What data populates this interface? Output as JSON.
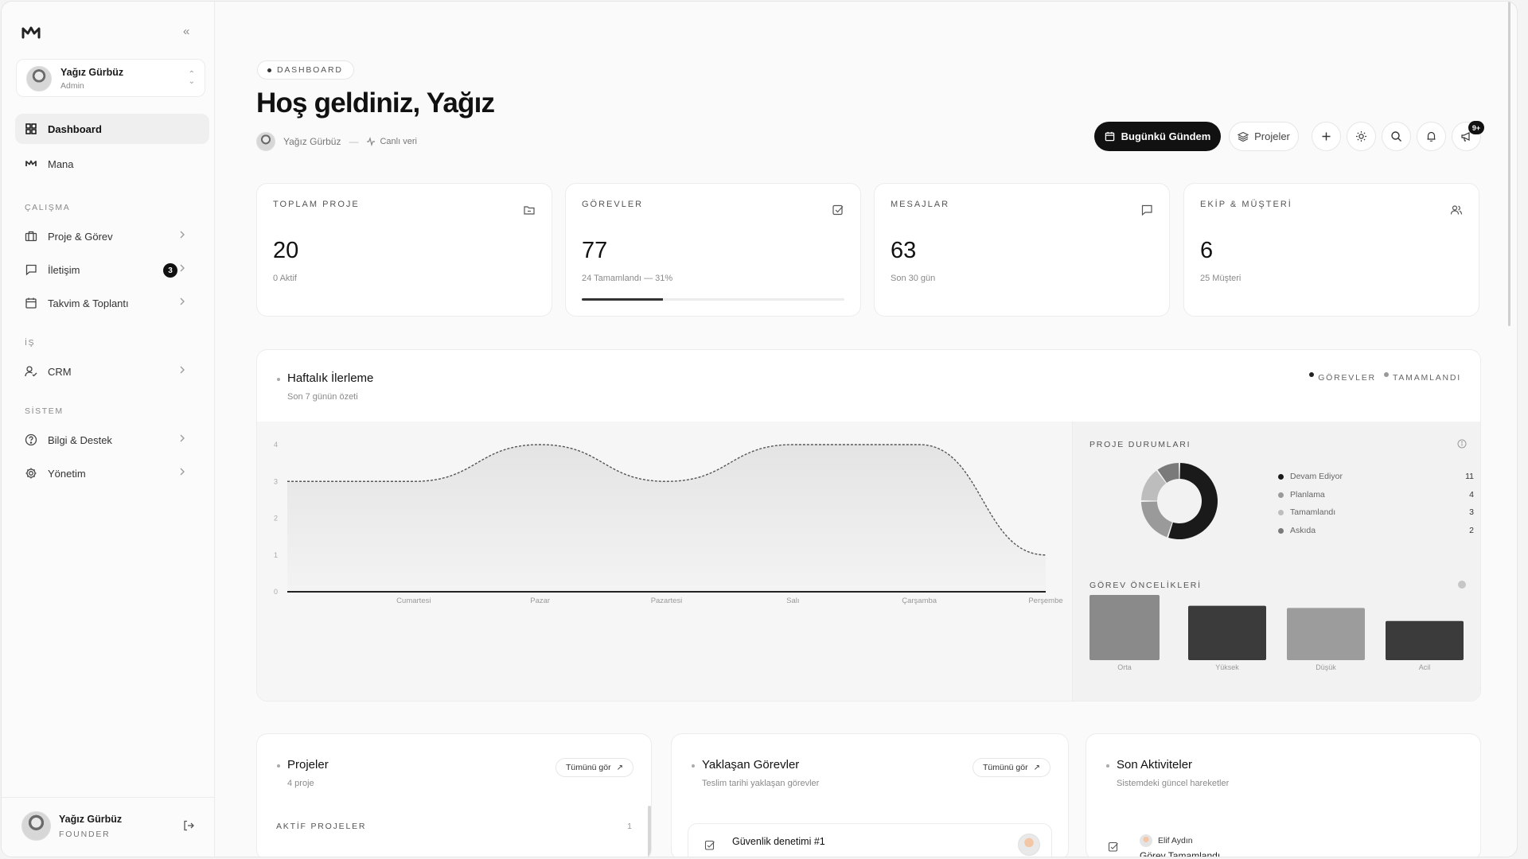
{
  "sidebar": {
    "user": {
      "name": "Yağız Gürbüz",
      "role": "Admin"
    },
    "nav_top": [
      {
        "label": "Dashboard",
        "icon": "dashboard-icon",
        "active": true
      },
      {
        "label": "Mana",
        "icon": "mana-logo-icon"
      }
    ],
    "sections": [
      {
        "label": "ÇALIŞMA",
        "items": [
          {
            "label": "Proje & Görev",
            "icon": "briefcase-icon"
          },
          {
            "label": "İletişim",
            "icon": "chat-icon",
            "badge": "3"
          },
          {
            "label": "Takvim & Toplantı",
            "icon": "calendar-icon"
          }
        ]
      },
      {
        "label": "İŞ",
        "items": [
          {
            "label": "CRM",
            "icon": "user-check-icon"
          }
        ]
      },
      {
        "label": "SİSTEM",
        "items": [
          {
            "label": "Bilgi & Destek",
            "icon": "help-icon"
          },
          {
            "label": "Yönetim",
            "icon": "gear-icon"
          }
        ]
      }
    ],
    "footer": {
      "name": "Yağız Gürbüz",
      "role": "FOUNDER"
    }
  },
  "header": {
    "breadcrumb": "DASHBOARD",
    "title": "Hoş geldiniz, Yağız",
    "user": "Yağız Gürbüz",
    "live": "Canlı veri",
    "agenda_button": "Bugünkü Gündem",
    "projects_button": "Projeler",
    "notif_badge": "9+"
  },
  "stats": [
    {
      "label": "TOPLAM PROJE",
      "value": "20",
      "sub": "0 Aktif",
      "icon": "folder-icon"
    },
    {
      "label": "GÖREVLER",
      "value": "77",
      "sub": "24 Tamamlandı — 31%",
      "icon": "check-square-icon",
      "progress": 0.31
    },
    {
      "label": "MESAJLAR",
      "value": "63",
      "sub": "Son 30 gün",
      "icon": "message-icon"
    },
    {
      "label": "EKİP & MÜŞTERİ",
      "value": "6",
      "sub": "25 Müşteri",
      "icon": "users-icon"
    }
  ],
  "weekly": {
    "title": "Haftalık İlerleme",
    "subtitle": "Son 7 günün özeti",
    "legend": [
      "GÖREVLER",
      "TAMAMLANDI"
    ],
    "status_title": "PROJE DURUMLARI",
    "priority_title": "GÖREV ÖNCELİKLERİ"
  },
  "chart_data": [
    {
      "type": "area",
      "title": "Haftalık İlerleme",
      "x": [
        "",
        "Cumartesi",
        "Pazar",
        "Pazartesi",
        "Salı",
        "Çarşamba",
        "Perşembe"
      ],
      "series": [
        {
          "name": "GÖREVLER",
          "values": [
            3,
            3,
            4,
            3,
            4,
            4,
            1
          ]
        },
        {
          "name": "TAMAMLANDI",
          "values": [
            0,
            0,
            0,
            0,
            0,
            0,
            0
          ]
        }
      ],
      "yticks": [
        "0",
        "1",
        "2",
        "3",
        "4"
      ],
      "ylim": [
        0,
        4
      ],
      "colors": {
        "line": "#555555",
        "fill": "#e4e4e4"
      }
    },
    {
      "type": "pie",
      "title": "PROJE DURUMLARI",
      "categories": [
        "Devam Ediyor",
        "Planlama",
        "Tamamlandı",
        "Askıda"
      ],
      "values": [
        11,
        4,
        3,
        2
      ],
      "colors": [
        "#1a1a1a",
        "#9a9a9a",
        "#bdbdbd",
        "#7a7a7a"
      ]
    },
    {
      "type": "bar",
      "title": "GÖREV ÖNCELİKLERİ",
      "categories": [
        "Orta",
        "Yüksek",
        "Düşük",
        "Acil"
      ],
      "values": [
        30,
        25,
        24,
        18
      ],
      "colors": [
        "#8a8a8a",
        "#3b3b3b",
        "#9c9c9c",
        "#3b3b3b"
      ]
    }
  ],
  "bottom": {
    "projects": {
      "title": "Projeler",
      "subtitle": "4 proje",
      "see_all": "Tümünü gör",
      "section": "AKTİF PROJELER",
      "count": "1"
    },
    "tasks": {
      "title": "Yaklaşan Görevler",
      "subtitle": "Teslim tarihi yaklaşan görevler",
      "see_all": "Tümünü gör",
      "first_task": "Güvenlik denetimi #1"
    },
    "activity": {
      "title": "Son Aktiviteler",
      "subtitle": "Sistemdeki güncel hareketler",
      "first_user": "Elif Aydın",
      "first_action": "Görev Tamamlandı"
    }
  }
}
